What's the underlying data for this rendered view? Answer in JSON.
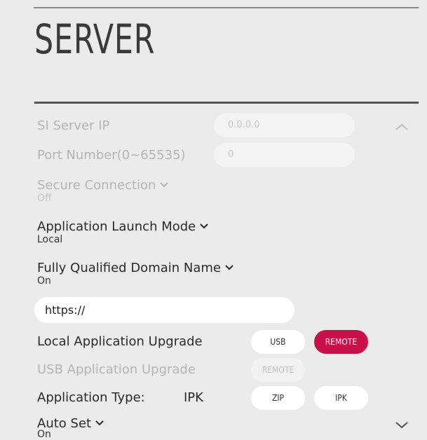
{
  "page": {
    "title": "SERVER"
  },
  "server_ip": {
    "label": "SI Server IP",
    "placeholder": "0.0.0.0"
  },
  "port": {
    "label": "Port Number(0~65535)",
    "placeholder": "0"
  },
  "secure_connection": {
    "label": "Secure Connection",
    "value": "Off"
  },
  "launch_mode": {
    "label": "Application Launch Mode",
    "value": "Local"
  },
  "fqdn": {
    "label": "Fully Qualified Domain Name",
    "value": "On",
    "url_value": "https://"
  },
  "local_upgrade": {
    "label": "Local Application Upgrade",
    "usb_label": "USB",
    "remote_label": "REMOTE"
  },
  "usb_upgrade": {
    "label": "USB Application Upgrade",
    "remote_label": "REMOTE"
  },
  "app_type": {
    "label": "Application Type:",
    "value": "IPK",
    "zip_label": "ZIP",
    "ipk_label": "IPK"
  },
  "auto_set": {
    "label": "Auto Set",
    "value": "On"
  },
  "colors": {
    "accent": "#c8104a",
    "background": "#ebebeb"
  },
  "icons": {
    "collapse": "chevron-up-icon",
    "expand": "chevron-down-icon",
    "dropdown": "chevron-down-icon"
  }
}
